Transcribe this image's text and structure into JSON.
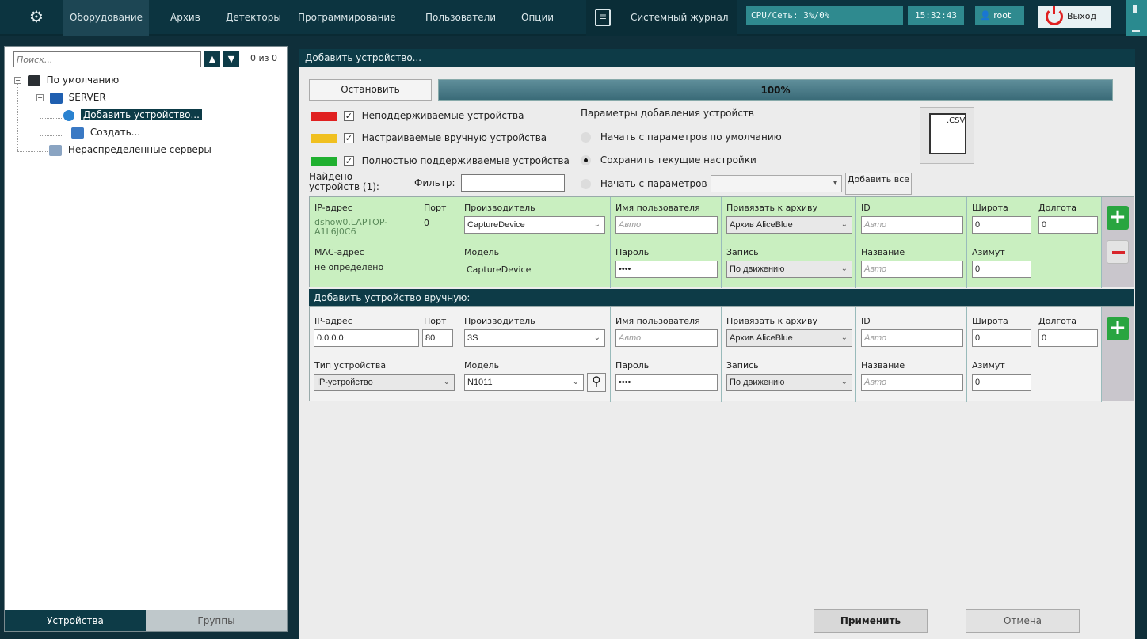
{
  "topbar": {
    "menu": [
      "Оборудование",
      "Архив",
      "Детекторы",
      "Программирование",
      "Пользователи",
      "Опции"
    ],
    "active_menu": "Оборудование",
    "journal_label": "Системный журнал",
    "cpu_net": "CPU/Сеть: 3%/0%",
    "time": "15:32:43",
    "user": "root",
    "exit_label": "Выход"
  },
  "leftpanel": {
    "search_placeholder": "Поиск...",
    "count": "0 из 0",
    "tree": {
      "root": "По умолчанию",
      "server": "SERVER",
      "add_device": "Добавить устройство...",
      "create": "Создать...",
      "unassigned": "Нераспределенные серверы"
    },
    "tabs": {
      "devices": "Устройства",
      "groups": "Группы"
    }
  },
  "main": {
    "header": "Добавить устройство...",
    "stop_button": "Остановить",
    "progress": {
      "value_percent": 100,
      "label": "100%"
    },
    "legend": {
      "unsupported": "Неподдерживаемые устройства",
      "manual": "Настраиваемые вручную устройства",
      "full": "Полностью поддерживаемые устройства"
    },
    "params": {
      "title": "Параметры добавления устройств",
      "opt_default": "Начать с параметров по умолчанию",
      "opt_keep": "Сохранить текущие настройки",
      "opt_params": "Начать с параметров"
    },
    "add_all": "Добавить все",
    "csv_label": ".CSV",
    "found_label": "Найдено устройств (1):",
    "filter_label": "Фильтр:",
    "found_device": {
      "ip_label": "IP-адрес",
      "ip_value": "dshow0.LAPTOP-A1L6J0C6",
      "port_label": "Порт",
      "port_value": "0",
      "mac_label": "MAC-адрес",
      "mac_value": "не определено",
      "vendor_label": "Производитель",
      "vendor_value": "CaptureDevice",
      "model_label": "Модель",
      "model_value": "CaptureDevice",
      "user_label": "Имя пользователя",
      "user_placeholder": "Авто",
      "pass_label": "Пароль",
      "pass_value": "••••",
      "archive_label": "Привязать к архиву",
      "archive_value": "Архив AliceBlue",
      "record_label": "Запись",
      "record_value": "По движению",
      "id_label": "ID",
      "id_placeholder": "Авто",
      "name_label": "Название",
      "name_placeholder": "Авто",
      "lat_label": "Широта",
      "lat_value": "0",
      "lon_label": "Долгота",
      "lon_value": "0",
      "az_label": "Азимут",
      "az_value": "0"
    },
    "manual_header": "Добавить устройство вручную:",
    "manual_device": {
      "ip_label": "IP-адрес",
      "ip_value": "0.0.0.0",
      "port_label": "Порт",
      "port_value": "80",
      "type_label": "Тип устройства",
      "type_value": "IP-устройство",
      "vendor_label": "Производитель",
      "vendor_value": "3S",
      "model_label": "Модель",
      "model_value": "N1011",
      "user_label": "Имя пользователя",
      "user_placeholder": "Авто",
      "pass_label": "Пароль",
      "pass_value": "••••",
      "archive_label": "Привязать к архиву",
      "archive_value": "Архив AliceBlue",
      "record_label": "Запись",
      "record_value": "По движению",
      "id_label": "ID",
      "id_placeholder": "Авто",
      "name_label": "Название",
      "name_placeholder": "Авто",
      "lat_label": "Широта",
      "lat_value": "0",
      "lon_label": "Долгота",
      "lon_value": "0",
      "az_label": "Азимут",
      "az_value": "0"
    },
    "apply_button": "Применить",
    "cancel_button": "Отмена"
  },
  "colors": {
    "topbar": "#0c3440",
    "accent": "#0d3b47",
    "found_row": "#c9efc0",
    "unsupported": "#e02020",
    "manual": "#f0c020",
    "full": "#20b030",
    "add_green": "#29a540"
  },
  "icons": [
    "gear-icon",
    "journal-icon",
    "user-icon",
    "power-icon",
    "chevron-up-icon",
    "chevron-down-icon",
    "server-icon",
    "monitor-icon",
    "search-icon",
    "plus-icon",
    "minus-icon",
    "csv-file-icon"
  ]
}
